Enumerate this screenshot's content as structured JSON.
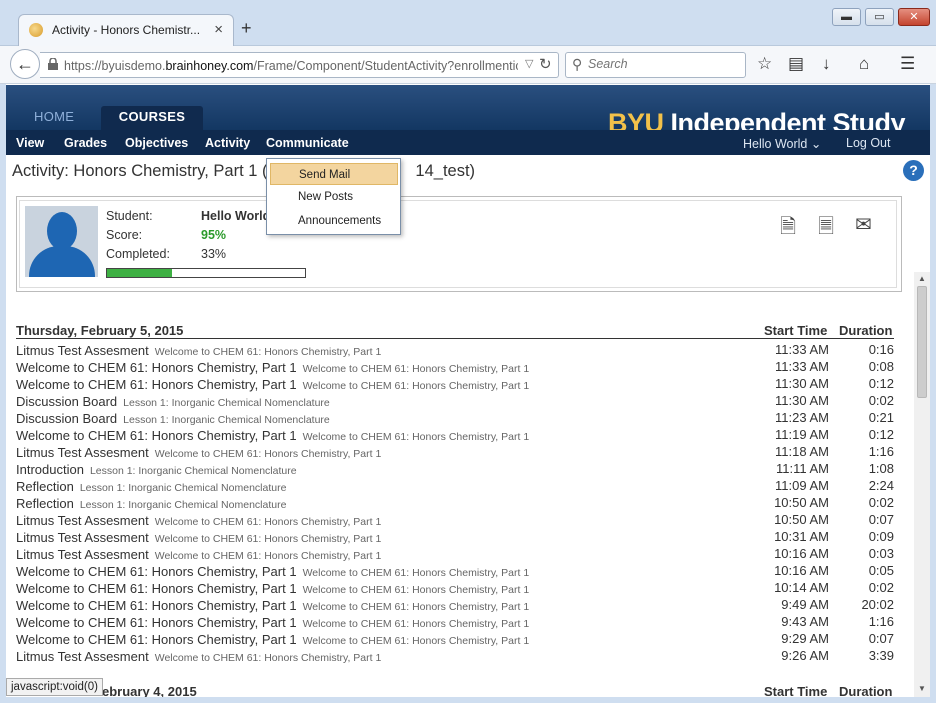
{
  "browser": {
    "tab_title": "Activity - Honors Chemistr...",
    "tab_close": "×",
    "new_tab": "+",
    "win_min": "▬",
    "win_max": "▭",
    "win_close": "✕",
    "url_prefix": "https://byuisdemo.",
    "url_domain": "brainhoney.com",
    "url_rest": "/Frame/Component/StudentActivity?enrollmentic",
    "search_placeholder": "Search",
    "status_text": "javascript:void(0)"
  },
  "header": {
    "home": "HOME",
    "courses": "COURSES",
    "logo_byu": "BYU",
    "logo_rest": " Independent Study",
    "user": "Hello World",
    "logout": "Log Out"
  },
  "subnav": [
    "View",
    "Grades",
    "Objectives",
    "Activity",
    "Communicate"
  ],
  "page": {
    "title": "Activity: Honors Chemistry, Part 1 (C",
    "title_tail": "14_test)",
    "help": "?"
  },
  "student": {
    "student_label": "Student:",
    "student_name": "Hello World",
    "score_label": "Score:",
    "score_value": "95%",
    "completed_label": "Completed:",
    "completed_value": "33%",
    "completed_fraction": 0.33
  },
  "communicate_menu": [
    "Send Mail",
    "New Posts",
    "Announcements"
  ],
  "activity": {
    "days": [
      {
        "date": "Thursday, February 5, 2015",
        "start_header": "Start Time",
        "duration_header": "Duration",
        "rows": [
          {
            "title": "Litmus Test Assesment",
            "course": "Welcome to CHEM 61: Honors Chemistry, Part 1",
            "time": "11:33 AM",
            "duration": "0:16"
          },
          {
            "title": "Welcome to CHEM 61: Honors Chemistry, Part 1",
            "course": "Welcome to CHEM 61: Honors Chemistry, Part 1",
            "time": "11:33 AM",
            "duration": "0:08"
          },
          {
            "title": "Welcome to CHEM 61: Honors Chemistry, Part 1",
            "course": "Welcome to CHEM 61: Honors Chemistry, Part 1",
            "time": "11:30 AM",
            "duration": "0:12"
          },
          {
            "title": "Discussion Board",
            "course": "Lesson 1: Inorganic Chemical Nomenclature",
            "time": "11:30 AM",
            "duration": "0:02"
          },
          {
            "title": "Discussion Board",
            "course": "Lesson 1: Inorganic Chemical Nomenclature",
            "time": "11:23 AM",
            "duration": "0:21"
          },
          {
            "title": "Welcome to CHEM 61: Honors Chemistry, Part 1",
            "course": "Welcome to CHEM 61: Honors Chemistry, Part 1",
            "time": "11:19 AM",
            "duration": "0:12"
          },
          {
            "title": "Litmus Test Assesment",
            "course": "Welcome to CHEM 61: Honors Chemistry, Part 1",
            "time": "11:18 AM",
            "duration": "1:16"
          },
          {
            "title": "Introduction",
            "course": "Lesson 1: Inorganic Chemical Nomenclature",
            "time": "11:11 AM",
            "duration": "1:08"
          },
          {
            "title": "Reflection",
            "course": "Lesson 1: Inorganic Chemical Nomenclature",
            "time": "11:09 AM",
            "duration": "2:24"
          },
          {
            "title": "Reflection",
            "course": "Lesson 1: Inorganic Chemical Nomenclature",
            "time": "10:50 AM",
            "duration": "0:02"
          },
          {
            "title": "Litmus Test Assesment",
            "course": "Welcome to CHEM 61: Honors Chemistry, Part 1",
            "time": "10:50 AM",
            "duration": "0:07"
          },
          {
            "title": "Litmus Test Assesment",
            "course": "Welcome to CHEM 61: Honors Chemistry, Part 1",
            "time": "10:31 AM",
            "duration": "0:09"
          },
          {
            "title": "Litmus Test Assesment",
            "course": "Welcome to CHEM 61: Honors Chemistry, Part 1",
            "time": "10:16 AM",
            "duration": "0:03"
          },
          {
            "title": "Welcome to CHEM 61: Honors Chemistry, Part 1",
            "course": "Welcome to CHEM 61: Honors Chemistry, Part 1",
            "time": "10:16 AM",
            "duration": "0:05"
          },
          {
            "title": "Welcome to CHEM 61: Honors Chemistry, Part 1",
            "course": "Welcome to CHEM 61: Honors Chemistry, Part 1",
            "time": "10:14 AM",
            "duration": "0:02"
          },
          {
            "title": "Welcome to CHEM 61: Honors Chemistry, Part 1",
            "course": "Welcome to CHEM 61: Honors Chemistry, Part 1",
            "time": "9:49 AM",
            "duration": "20:02"
          },
          {
            "title": "Welcome to CHEM 61: Honors Chemistry, Part 1",
            "course": "Welcome to CHEM 61: Honors Chemistry, Part 1",
            "time": "9:43 AM",
            "duration": "1:16"
          },
          {
            "title": "Welcome to CHEM 61: Honors Chemistry, Part 1",
            "course": "Welcome to CHEM 61: Honors Chemistry, Part 1",
            "time": "9:29 AM",
            "duration": "0:07"
          },
          {
            "title": "Litmus Test Assesment",
            "course": "Welcome to CHEM 61: Honors Chemistry, Part 1",
            "time": "9:26 AM",
            "duration": "3:39"
          }
        ]
      },
      {
        "date": "ebruary 4, 2015",
        "start_header": "Start Time",
        "duration_header": "Duration",
        "rows": []
      }
    ]
  }
}
